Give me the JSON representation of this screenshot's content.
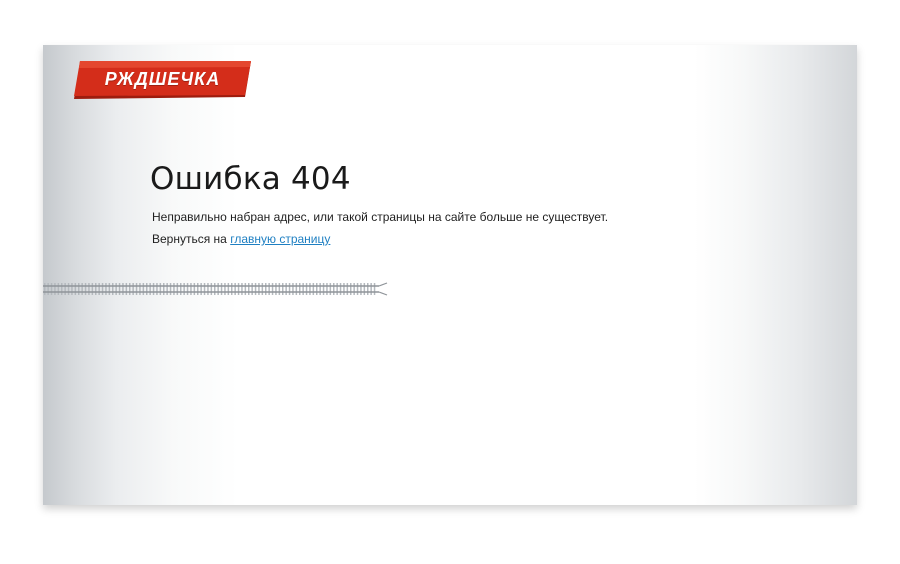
{
  "brand": {
    "logo_text": "РЖДШЕЧКА",
    "logo_color": "#d42d1a"
  },
  "error": {
    "title": "Ошибка 404",
    "message": "Неправильно набран адрес, или такой страницы на сайте больше не существует.",
    "back_prefix": "Вернуться на",
    "back_link_label": "главную страницу"
  },
  "colors": {
    "link": "#1e7fc2",
    "text": "#1f1f1f"
  }
}
